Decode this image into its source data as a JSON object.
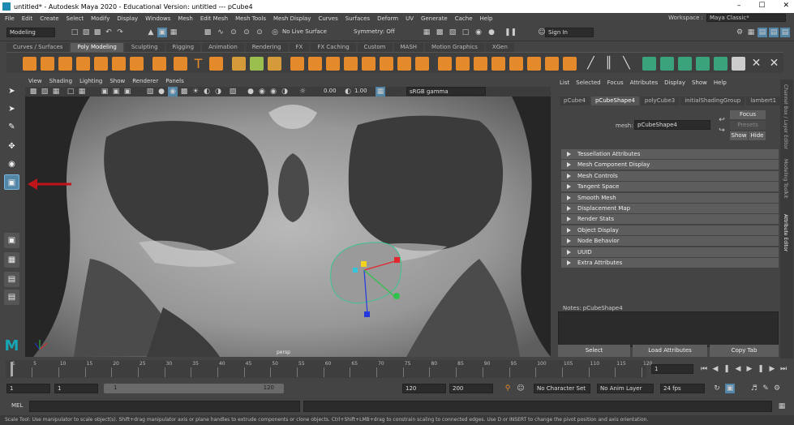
{
  "window": {
    "title": "untitled* - Autodesk Maya 2020 - Educational Version: untitled   ---   pCube4",
    "min": "–",
    "max": "☐",
    "close": "✕"
  },
  "menubar": [
    "File",
    "Edit",
    "Create",
    "Select",
    "Modify",
    "Display",
    "Windows",
    "Mesh",
    "Edit Mesh",
    "Mesh Tools",
    "Mesh Display",
    "Curves",
    "Surfaces",
    "Deform",
    "UV",
    "Generate",
    "Cache",
    "Help"
  ],
  "workspace": {
    "label": "Workspace :",
    "value": "Maya Classic*"
  },
  "statusline": {
    "mode": "Modeling",
    "live_surface": "No Live Surface",
    "symmetry": "Symmetry: Off",
    "sign_in": "Sign In"
  },
  "shelf": {
    "tabs": [
      "Curves / Surfaces",
      "Poly Modeling",
      "Sculpting",
      "Rigging",
      "Animation",
      "Rendering",
      "FX",
      "FX Caching",
      "Custom",
      "MASH",
      "Motion Graphics",
      "XGen"
    ],
    "active_tab": "Poly Modeling"
  },
  "viewport": {
    "menu": [
      "View",
      "Shading",
      "Lighting",
      "Show",
      "Renderer",
      "Panels"
    ],
    "near": "0.00",
    "far": "1.00",
    "colorspace": "sRGB gamma",
    "camera_label": "persp"
  },
  "attribute_editor": {
    "menu": [
      "List",
      "Selected",
      "Focus",
      "Attributes",
      "Display",
      "Show",
      "Help"
    ],
    "tabs": [
      "pCube4",
      "pCubeShape4",
      "polyCube3",
      "initialShadingGroup",
      "lambert1"
    ],
    "active_tab": "pCubeShape4",
    "mesh_label": "mesh:",
    "mesh_value": "pCubeShape4",
    "focus": "Focus",
    "presets": "Presets",
    "show": "Show",
    "hide": "Hide",
    "sections": [
      "Tessellation Attributes",
      "Mesh Component Display",
      "Mesh Controls",
      "Tangent Space",
      "Smooth Mesh",
      "Displacement Map",
      "Render Stats",
      "Object Display",
      "Node Behavior",
      "UUID",
      "Extra Attributes"
    ],
    "notes": "Notes:  pCubeShape4",
    "buttons": [
      "Select",
      "Load Attributes",
      "Copy Tab"
    ],
    "side_tabs": [
      "Channel Box / Layer Editor",
      "Modeling Toolkit",
      "Attribute Editor"
    ]
  },
  "timeline": {
    "ticks": [
      "1",
      "5",
      "10",
      "15",
      "20",
      "25",
      "30",
      "35",
      "40",
      "45",
      "50",
      "55",
      "60",
      "65",
      "70",
      "75",
      "80",
      "85",
      "90",
      "95",
      "100",
      "105",
      "110",
      "115",
      "120"
    ],
    "current_frame": "1"
  },
  "range": {
    "start": "1",
    "start2": "1",
    "slider_start": "1",
    "slider_end": "120",
    "end": "120",
    "end2": "200",
    "char_set": "No Character Set",
    "anim_layer": "No Anim Layer",
    "fps": "24 fps"
  },
  "cmdline": {
    "label": "MEL"
  },
  "helpline": "Scale Tool: Use manipulator to scale object(s). Shift+drag manipulator axis or plane handles to extrude components or clone objects. Ctrl+Shift+LMB+drag to constrain scaling to connected edges. Use D or INSERT to change the pivot position and axis orientation.",
  "colors": {
    "accent": "#5285a6",
    "arrow": "#c0141b",
    "maya_logo": "#16a6b5"
  }
}
